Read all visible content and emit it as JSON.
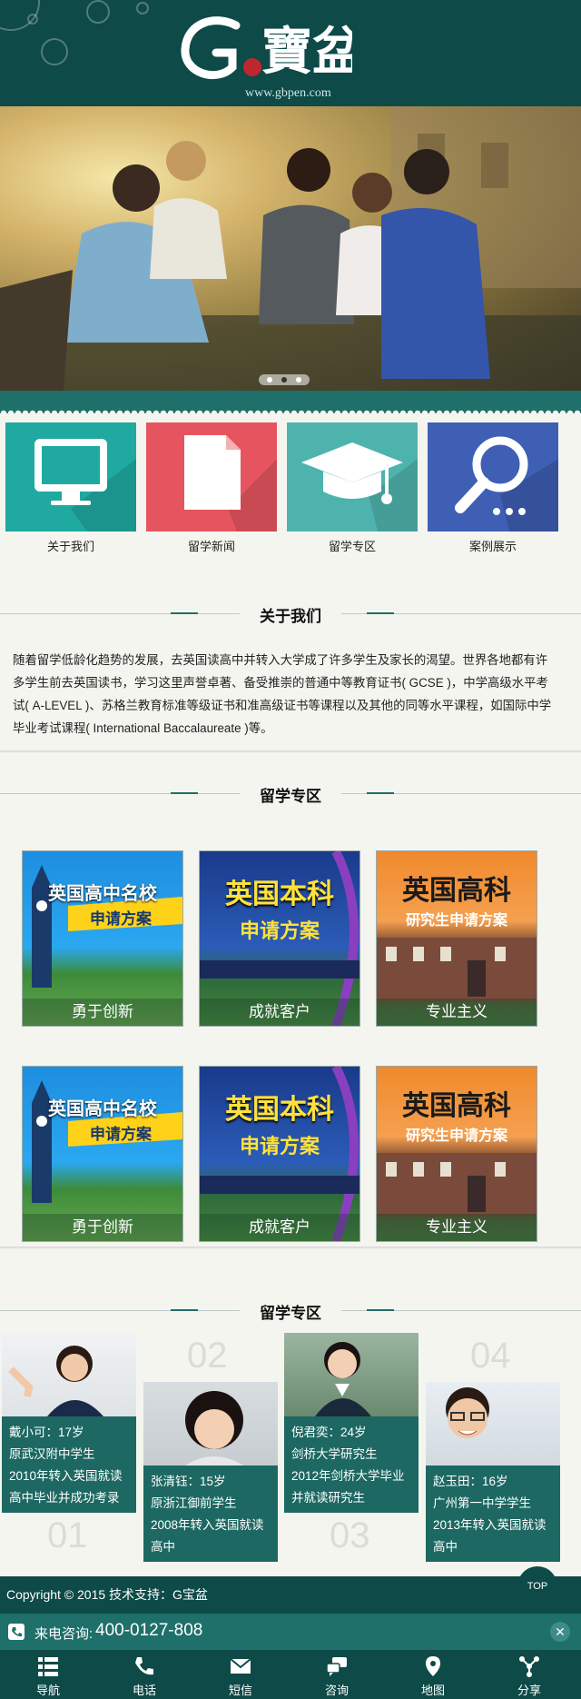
{
  "header": {
    "logo_text": "寶盆",
    "logo_letter": "G",
    "url": "www.gbpen.com"
  },
  "banner": {
    "slides": 3,
    "active_slide": 2
  },
  "nav_tiles": [
    {
      "label": "关于我们",
      "icon": "monitor-icon",
      "color": "#1fa9a0"
    },
    {
      "label": "留学新闻",
      "icon": "document-icon",
      "color": "#e6555f"
    },
    {
      "label": "留学专区",
      "icon": "graduation-cap-icon",
      "color": "#4fb3ad"
    },
    {
      "label": "案例展示",
      "icon": "search-icon",
      "color": "#3e5fb4"
    }
  ],
  "about": {
    "title": "关于我们",
    "text": "随着留学低龄化趋势的发展，去英国读高中并转入大学成了许多学生及家长的渴望。世界各地都有许多学生前去英国读书，学习这里声誉卓著、备受推崇的普通中等教育证书( GCSE )，中学高级水平考试( A-LEVEL )、苏格兰教育标准等级证书和准高级证书等课程以及其他的同等水平课程，如国际中学毕业考试课程( International Baccalaureate )等。"
  },
  "study_zone": {
    "title": "留学专区",
    "promos": [
      {
        "caption": "勇于创新",
        "line1": "英国高中名校",
        "line2": "申请方案",
        "theme": "blue"
      },
      {
        "caption": "成就客户",
        "line1": "英国本科",
        "line2": "申请方案",
        "theme": "navy"
      },
      {
        "caption": "专业主义",
        "line1": "英国高科",
        "line2": "研究生申请方案",
        "theme": "orange"
      },
      {
        "caption": "勇于创新",
        "line1": "英国高中名校",
        "line2": "申请方案",
        "theme": "blue"
      },
      {
        "caption": "成就客户",
        "line1": "英国本科",
        "line2": "申请方案",
        "theme": "navy"
      },
      {
        "caption": "专业主义",
        "line1": "英国高科",
        "line2": "研究生申请方案",
        "theme": "orange"
      }
    ]
  },
  "students_section": {
    "title": "留学专区",
    "students": [
      {
        "num": "01",
        "lines": [
          "戴小可：17岁",
          "原武汉附中学生",
          "2010年转入英国就读",
          "高中毕业并成功考录"
        ]
      },
      {
        "num": "02",
        "lines": [
          "张清钰：15岁",
          "原浙江御前学生",
          "2008年转入英国就读",
          "高中"
        ]
      },
      {
        "num": "03",
        "lines": [
          "倪君奕：24岁",
          "剑桥大学研究生",
          "2012年剑桥大学毕业",
          "并就读研究生"
        ]
      },
      {
        "num": "04",
        "lines": [
          "赵玉田：16岁",
          "广州第一中学学生",
          "2013年转入英国就读",
          "高中"
        ]
      }
    ]
  },
  "footer": {
    "copyright": "Copyright © 2015 技术支持：G宝盆",
    "phone_label": "来电咨询:",
    "phone": "400-0127-808",
    "top_label": "TOP"
  },
  "bottom_nav": [
    {
      "label": "导航",
      "icon": "menu-icon"
    },
    {
      "label": "电话",
      "icon": "phone-icon"
    },
    {
      "label": "短信",
      "icon": "envelope-icon"
    },
    {
      "label": "咨询",
      "icon": "chat-icon"
    },
    {
      "label": "地图",
      "icon": "map-pin-icon"
    },
    {
      "label": "分享",
      "icon": "share-icon"
    }
  ]
}
